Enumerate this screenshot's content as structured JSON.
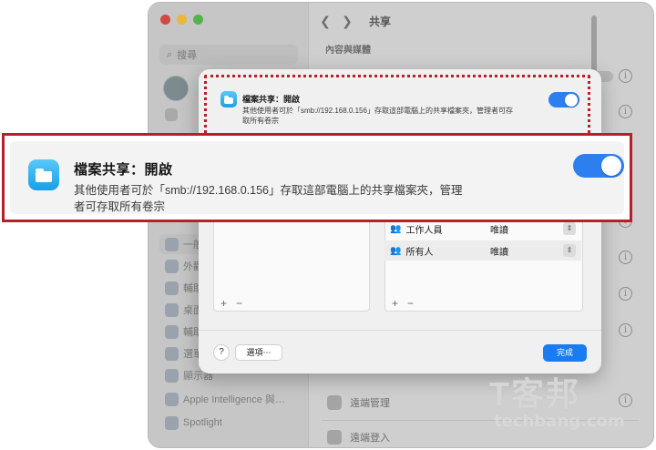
{
  "window": {
    "title": "共享",
    "back_arrow": "❮",
    "forward_arrow": "❯",
    "section_title": "內容與媒體"
  },
  "sidebar": {
    "search_placeholder": "搜尋",
    "items": [
      {
        "label": "一般",
        "icon": "gear-icon"
      },
      {
        "label": "外觀",
        "icon": "appearance-icon"
      },
      {
        "label": "輔助",
        "icon": "accessibility-icon"
      },
      {
        "label": "桌面",
        "icon": "desktop-icon"
      },
      {
        "label": "輔助",
        "icon": "accessibility-icon"
      },
      {
        "label": "選單",
        "icon": "menu-icon"
      },
      {
        "label": "顯示器",
        "icon": "display-icon"
      },
      {
        "label": "Apple Intelligence 與…",
        "icon": "apple-intelligence-icon"
      },
      {
        "label": "Spotlight",
        "icon": "spotlight-icon"
      }
    ]
  },
  "background_rows": [
    {
      "label": "遠端管理",
      "icon": "remote-management-icon"
    },
    {
      "label": "遠端登入",
      "icon": "remote-login-icon"
    }
  ],
  "sheet": {
    "title": "檔案共享：開啟",
    "description": "其他使用者可於「smb://192.168.0.156」存取這部電腦上的共享檔案夾，管理者可存取所有卷宗",
    "toggle_on": true,
    "permissions": [
      {
        "user": "工作人員",
        "access": "唯讀"
      },
      {
        "user": "所有人",
        "access": "唯讀"
      }
    ],
    "add_label": "+",
    "remove_label": "−",
    "help_label": "?",
    "options_label": "選項⋯",
    "done_label": "完成"
  },
  "callout": {
    "title": "檔案共享：開啟",
    "description_line1": "其他使用者可於「smb://192.168.0.156」存取這部電腦上的共享檔案夾，管理",
    "description_line2": "者可存取所有卷宗"
  },
  "watermark": {
    "mark": "T客邦",
    "text": "techbang.com"
  },
  "colors": {
    "accent": "#1a7cf2",
    "highlight": "#b81f26"
  }
}
